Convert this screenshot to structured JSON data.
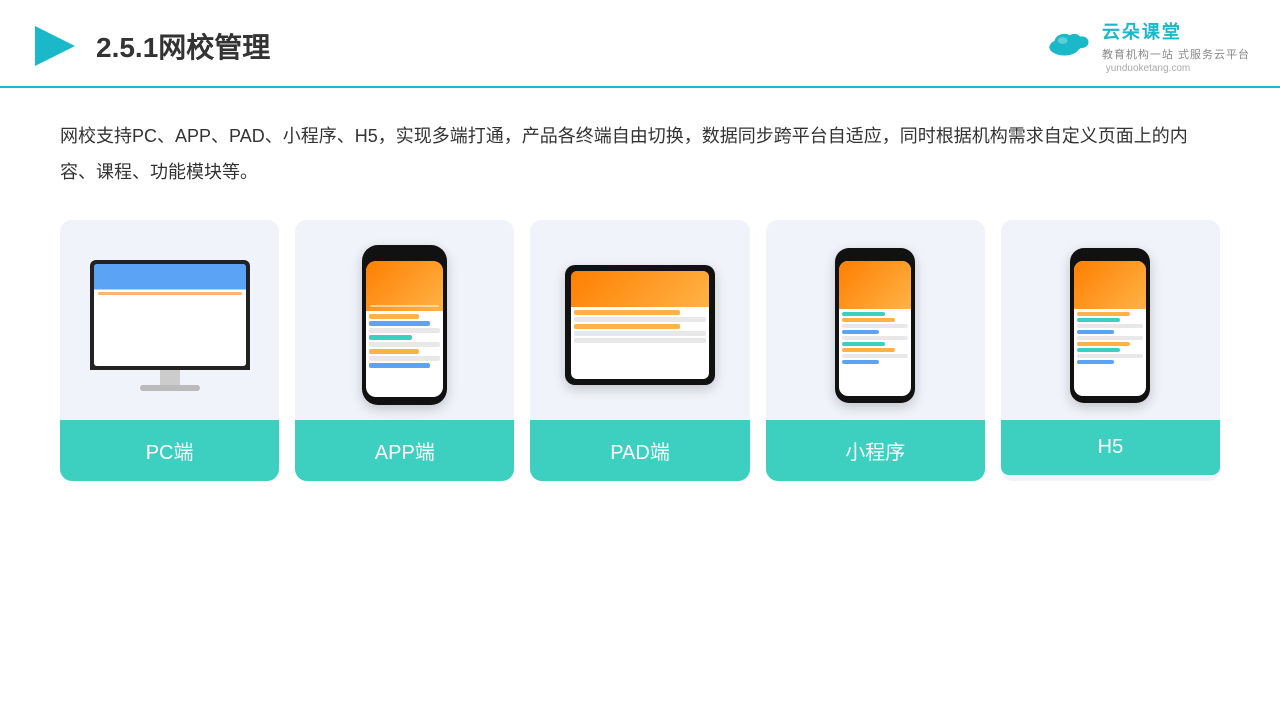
{
  "header": {
    "title": "2.5.1网校管理",
    "logo_main": "云朵课堂",
    "logo_url": "yunduoketang.com",
    "logo_tagline": "教育机构一站 式服务云平台"
  },
  "description": "网校支持PC、APP、PAD、小程序、H5，实现多端打通，产品各终端自由切换，数据同步跨平台自适应，同时根据机构需求自定义页面上的内容、课程、功能模块等。",
  "cards": [
    {
      "id": "pc",
      "label": "PC端"
    },
    {
      "id": "app",
      "label": "APP端"
    },
    {
      "id": "pad",
      "label": "PAD端"
    },
    {
      "id": "miniprogram",
      "label": "小程序"
    },
    {
      "id": "h5",
      "label": "H5"
    }
  ],
  "colors": {
    "accent": "#1ab8c8",
    "card_label_bg": "#3dcfc0",
    "card_bg": "#f0f4fa",
    "title_color": "#333333"
  }
}
